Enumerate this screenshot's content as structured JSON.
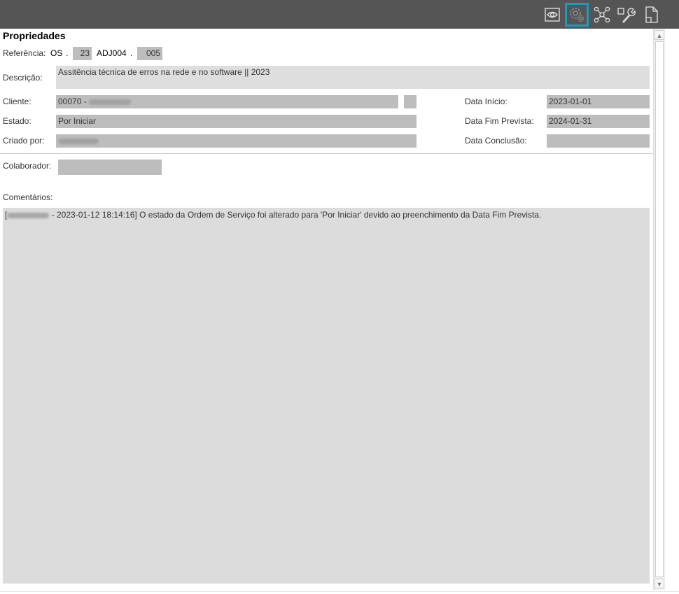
{
  "toolbar": {
    "buttons": [
      {
        "name": "preview",
        "icon": "eye-icon"
      },
      {
        "name": "settings",
        "icon": "gear-settings-icon",
        "active": true
      },
      {
        "name": "network",
        "icon": "network-nodes-icon"
      },
      {
        "name": "tools",
        "icon": "wrench-icon"
      },
      {
        "name": "export",
        "icon": "document-export-icon"
      }
    ],
    "accent": "#1a9bbf",
    "background": "#555555"
  },
  "properties": {
    "title": "Propriedades",
    "referencia": {
      "label": "Referência:",
      "prefix": "OS",
      "sep1": ".",
      "number": "23",
      "code": "ADJ004",
      "sep2": ".",
      "sequence": "005"
    },
    "descricao": {
      "label": "Descrição:",
      "value": "Assitência técnica de erros na rede e no software || 2023"
    },
    "cliente": {
      "label": "Cliente:",
      "value": "00070 -"
    },
    "estado": {
      "label": "Estado:",
      "value": "Por Iniciar"
    },
    "criado_por": {
      "label": "Criado por:",
      "value": ""
    },
    "data_inicio": {
      "label": "Data Início:",
      "value": "2023-01-01"
    },
    "data_fim_prevista": {
      "label": "Data Fim Prevista:",
      "value": "2024-01-31"
    },
    "data_conclusao": {
      "label": "Data Conclusão:",
      "value": ""
    },
    "colaborador": {
      "label": "Colaborador:",
      "value": ""
    },
    "comentarios": {
      "label": "Comentários:",
      "open_bracket": "[",
      "text": " - 2023-01-12 18:14:16] O estado da Ordem de Serviço foi alterado para 'Por Iniciar' devido ao preenchimento da Data Fim Prevista."
    }
  }
}
